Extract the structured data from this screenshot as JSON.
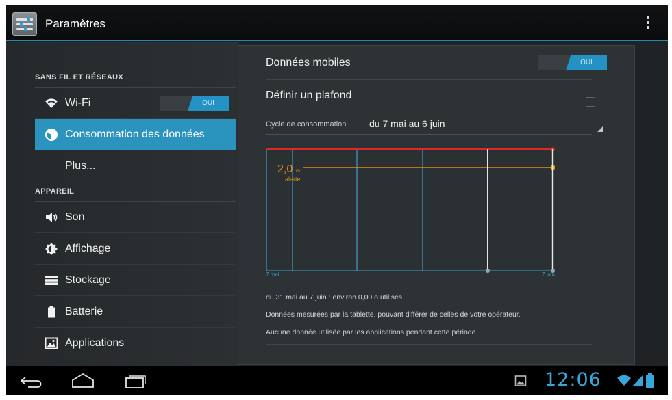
{
  "action_bar": {
    "title": "Paramètres",
    "icon": "settings-app-icon",
    "menu_icon": "overflow-menu-icon"
  },
  "sidebar": {
    "sections": [
      {
        "header": "SANS FIL ET RÉSEAUX",
        "items": [
          {
            "label": "Wi-Fi",
            "icon": "wifi-icon",
            "switch": "OUI",
            "selected": false
          },
          {
            "label": "Consommation des données",
            "icon": "data-usage-icon",
            "selected": true
          },
          {
            "label": "Plus...",
            "icon": "",
            "selected": false
          }
        ]
      },
      {
        "header": "APPAREIL",
        "items": [
          {
            "label": "Son",
            "icon": "speaker-icon",
            "selected": false
          },
          {
            "label": "Affichage",
            "icon": "brightness-icon",
            "selected": false
          },
          {
            "label": "Stockage",
            "icon": "storage-icon",
            "selected": false
          },
          {
            "label": "Batterie",
            "icon": "battery-icon",
            "selected": false
          },
          {
            "label": "Applications",
            "icon": "applications-icon",
            "selected": false
          }
        ]
      }
    ]
  },
  "data_usage": {
    "mobile_data_label": "Données mobiles",
    "mobile_data_switch": "OUI",
    "limit_label": "Définir un plafond",
    "limit_checked": false,
    "cycle_label": "Cycle de consommation",
    "cycle_value": "du 7 mai au 6 juin",
    "warning_value": "2,0",
    "warning_unit": "Go",
    "warning_label": "alerte",
    "axis_start": "7 mai",
    "axis_end": "7 juin",
    "usage_summary": "du 31 mai au 7 juin : environ 0,00 o utilisés",
    "note_1": "Données mesurées par la tablette, pouvant différer de celles de votre opérateur.",
    "note_2": "Aucune donnée utilisée par les applications pendant cette période.",
    "colors": {
      "limit": "#e0262b",
      "warning": "#e08f1b",
      "accent": "#2a94bf",
      "grid": "#3d9ec8"
    }
  },
  "nav_bar": {
    "back_icon": "back-icon",
    "home_icon": "home-icon",
    "recents_icon": "recent-apps-icon",
    "notification_icon": "image-notification-icon",
    "clock": "12:06",
    "status_icons": [
      "wifi-signal-icon",
      "cell-signal-icon",
      "battery-status-icon"
    ]
  }
}
